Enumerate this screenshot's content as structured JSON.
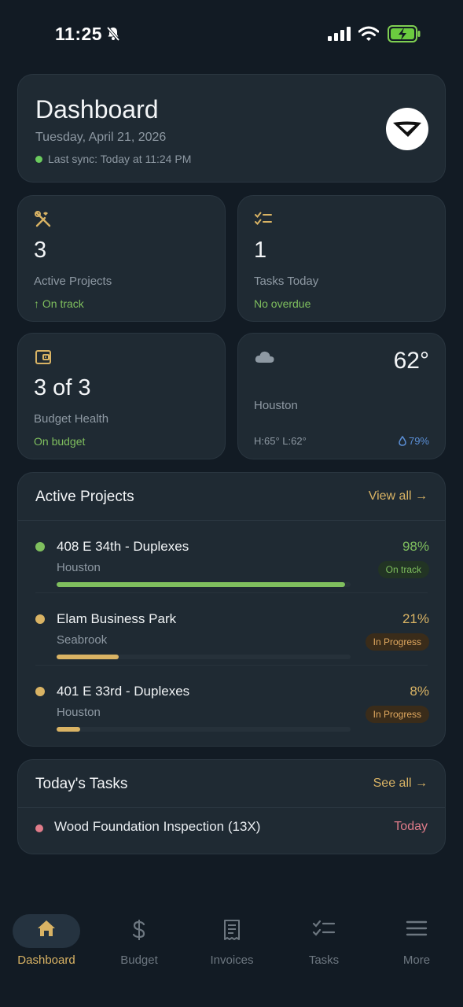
{
  "status_bar": {
    "time": "11:25"
  },
  "header": {
    "title": "Dashboard",
    "date": "Tuesday, April 21, 2026",
    "sync": "Last sync: Today at 11:24 PM"
  },
  "stats": {
    "projects": {
      "value": "3",
      "label": "Active Projects",
      "sub": "↑ On track",
      "icon": "tools-icon"
    },
    "tasks": {
      "value": "1",
      "label": "Tasks Today",
      "sub": "No overdue",
      "icon": "checklist-icon"
    },
    "budget": {
      "value": "3 of 3",
      "label": "Budget Health",
      "sub": "On budget",
      "icon": "wallet-icon"
    },
    "weather": {
      "temp": "62°",
      "city": "Houston",
      "hilo": "H:65° L:62°",
      "humidity": "79%",
      "icon": "cloud-icon"
    }
  },
  "active_projects": {
    "title": "Active Projects",
    "link": "View all →",
    "items": [
      {
        "name": "408 E 34th - Duplexes",
        "city": "Houston",
        "pct": "98%",
        "progress": 0.98,
        "status": "On track",
        "color": "#7fbf5e"
      },
      {
        "name": "Elam Business Park",
        "city": "Seabrook",
        "pct": "21%",
        "progress": 0.21,
        "status": "In Progress",
        "color": "#d9b364"
      },
      {
        "name": "401 E 33rd - Duplexes",
        "city": "Houston",
        "pct": "8%",
        "progress": 0.08,
        "status": "In Progress",
        "color": "#d9b364"
      }
    ]
  },
  "todays_tasks": {
    "title": "Today's Tasks",
    "link": "See all →",
    "items": [
      {
        "name": "Wood Foundation Inspection (13X)",
        "when": "Today"
      }
    ]
  },
  "tabbar": {
    "tabs": [
      {
        "label": "Dashboard",
        "icon": "home-icon",
        "active": true
      },
      {
        "label": "Budget",
        "icon": "dollar-icon",
        "active": false
      },
      {
        "label": "Invoices",
        "icon": "receipt-icon",
        "active": false
      },
      {
        "label": "Tasks",
        "icon": "checklist-icon",
        "active": false
      },
      {
        "label": "More",
        "icon": "menu-icon",
        "active": false
      }
    ]
  },
  "colors": {
    "accent": "#d9b364",
    "good": "#7fbf5e",
    "alert": "#e07c8a",
    "bg": "#121b24",
    "card": "#1f2a33"
  }
}
